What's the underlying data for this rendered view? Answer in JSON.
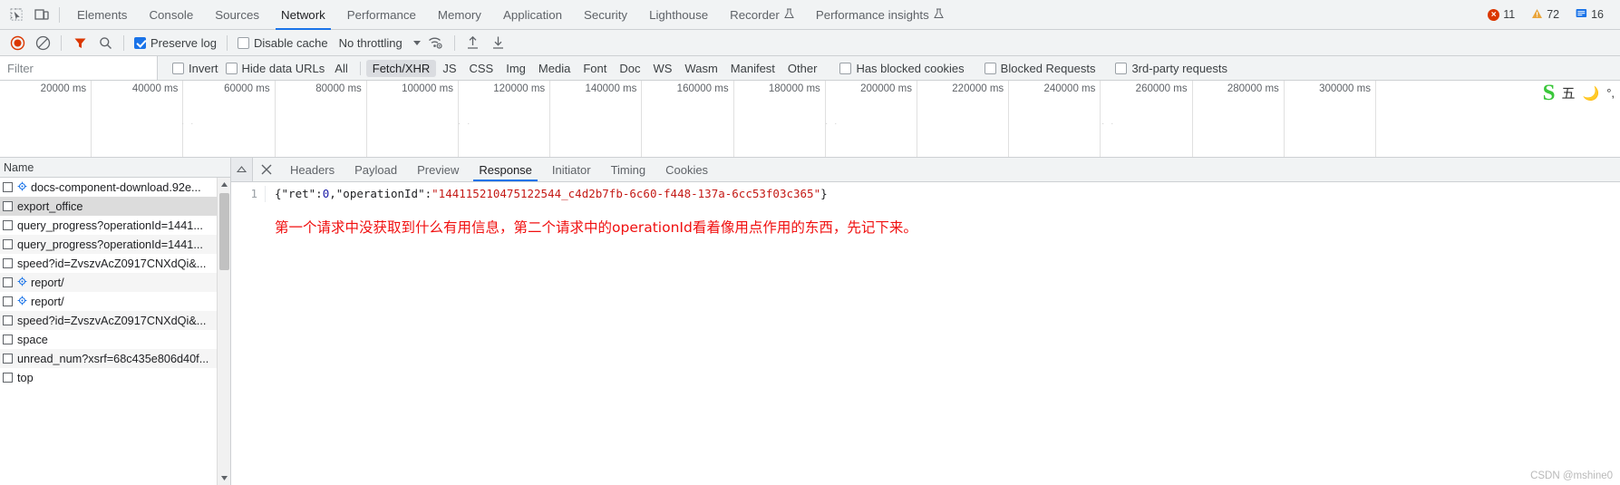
{
  "tabbar": {
    "inspect_icon": "inspect-cursor-icon",
    "device_icon": "device-toolbar-icon",
    "tabs": [
      {
        "label": "Elements",
        "active": false,
        "flask": false
      },
      {
        "label": "Console",
        "active": false,
        "flask": false
      },
      {
        "label": "Sources",
        "active": false,
        "flask": false
      },
      {
        "label": "Network",
        "active": true,
        "flask": false
      },
      {
        "label": "Performance",
        "active": false,
        "flask": false
      },
      {
        "label": "Memory",
        "active": false,
        "flask": false
      },
      {
        "label": "Application",
        "active": false,
        "flask": false
      },
      {
        "label": "Security",
        "active": false,
        "flask": false
      },
      {
        "label": "Lighthouse",
        "active": false,
        "flask": false
      },
      {
        "label": "Recorder",
        "active": false,
        "flask": true
      },
      {
        "label": "Performance insights",
        "active": false,
        "flask": true
      }
    ],
    "counters": {
      "errors": "11",
      "warnings": "72",
      "info": "16",
      "error_color": "#db3700",
      "warning_color": "#e9a53c",
      "info_color": "#1a73e8"
    }
  },
  "netbar": {
    "record_icon": "record-button-icon",
    "record_color": "#db3700",
    "clear_icon": "clear-icon",
    "filter_icon": "filter-funnel-icon",
    "filter_icon_color": "#db3700",
    "search_icon": "search-icon",
    "preserve_log": {
      "label": "Preserve log",
      "checked": true
    },
    "disable_cache": {
      "label": "Disable cache",
      "checked": false
    },
    "throttling": {
      "value": "No throttling"
    },
    "wifi_icon": "network-conditions-icon",
    "import_icon": "import-har-icon",
    "export_icon": "export-har-icon"
  },
  "filterbar": {
    "filter_placeholder": "Filter",
    "filter_value": "",
    "invert": {
      "label": "Invert",
      "checked": false
    },
    "hide_data_urls": {
      "label": "Hide data URLs",
      "checked": false
    },
    "types": [
      {
        "label": "All",
        "selected": false
      },
      {
        "label": "Fetch/XHR",
        "selected": true
      },
      {
        "label": "JS",
        "selected": false
      },
      {
        "label": "CSS",
        "selected": false
      },
      {
        "label": "Img",
        "selected": false
      },
      {
        "label": "Media",
        "selected": false
      },
      {
        "label": "Font",
        "selected": false
      },
      {
        "label": "Doc",
        "selected": false
      },
      {
        "label": "WS",
        "selected": false
      },
      {
        "label": "Wasm",
        "selected": false
      },
      {
        "label": "Manifest",
        "selected": false
      },
      {
        "label": "Other",
        "selected": false
      }
    ],
    "has_blocked_cookies": {
      "label": "Has blocked cookies",
      "checked": false
    },
    "blocked_requests": {
      "label": "Blocked Requests",
      "checked": false
    },
    "third_party": {
      "label": "3rd-party requests",
      "checked": false
    }
  },
  "overview": {
    "ticks": [
      "20000 ms",
      "40000 ms",
      "60000 ms",
      "80000 ms",
      "100000 ms",
      "120000 ms",
      "140000 ms",
      "160000 ms",
      "180000 ms",
      "200000 ms",
      "220000 ms",
      "240000 ms",
      "260000 ms",
      "280000 ms",
      "300000 ms"
    ]
  },
  "ime": {
    "logo": "S",
    "mode": "五",
    "moon_icon": "moon-icon",
    "punct_icon": "punctuation-icon"
  },
  "requests": {
    "column_header": "Name",
    "rows": [
      {
        "name": "docs-component-download.92e...",
        "icon": "gear-icon",
        "selected": false
      },
      {
        "name": "export_office",
        "icon": "",
        "selected": true
      },
      {
        "name": "query_progress?operationId=1441...",
        "icon": "",
        "selected": false
      },
      {
        "name": "query_progress?operationId=1441...",
        "icon": "",
        "selected": false
      },
      {
        "name": "speed?id=ZvszvAcZ0917CNXdQi&...",
        "icon": "",
        "selected": false
      },
      {
        "name": "report/",
        "icon": "gear-icon",
        "selected": false
      },
      {
        "name": "report/",
        "icon": "gear-icon",
        "selected": false
      },
      {
        "name": "speed?id=ZvszvAcZ0917CNXdQi&...",
        "icon": "",
        "selected": false
      },
      {
        "name": "space",
        "icon": "",
        "selected": false
      },
      {
        "name": "unread_num?xsrf=68c435e806d40f...",
        "icon": "",
        "selected": false
      },
      {
        "name": "top",
        "icon": "",
        "selected": false
      }
    ]
  },
  "detail": {
    "close_icon": "close-icon",
    "collapse_icon": "collapse-icon",
    "tabs": [
      {
        "label": "Headers",
        "active": false
      },
      {
        "label": "Payload",
        "active": false
      },
      {
        "label": "Preview",
        "active": false
      },
      {
        "label": "Response",
        "active": true
      },
      {
        "label": "Initiator",
        "active": false
      },
      {
        "label": "Timing",
        "active": false
      },
      {
        "label": "Cookies",
        "active": false
      }
    ],
    "response": {
      "line_number": "1",
      "open_brace": "{",
      "key_ret": "\"ret\"",
      "colon1": ":",
      "val_ret": "0",
      "comma": ",",
      "key_op": "\"operationId\"",
      "colon2": ":",
      "val_op": "\"144115210475122544_c4d2b7fb-6c60-f448-137a-6cc53f03c365\"",
      "close_brace": "}"
    },
    "annotation": "第一个请求中没获取到什么有用信息，第二个请求中的operationId看着像用点作用的东西，先记下来。",
    "annotation_color": "#f01010"
  },
  "watermark": "CSDN @mshine0"
}
